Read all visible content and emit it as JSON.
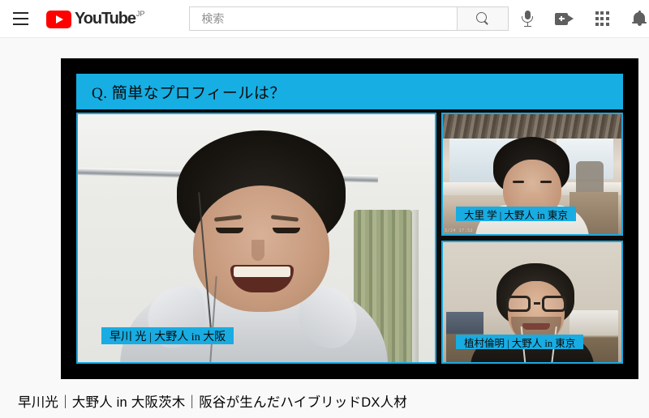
{
  "header": {
    "menu_icon": "hamburger-icon",
    "logo": {
      "wordmark": "YouTube",
      "country_code": "JP",
      "play_icon": "play-triangle-icon",
      "brand_color": "#ff0000"
    },
    "search": {
      "value": "",
      "placeholder": "検索",
      "button_icon": "search-icon"
    },
    "icons": [
      {
        "name": "microphone-icon",
        "label": "音声で検索"
      },
      {
        "name": "video-camera-plus-icon",
        "label": "作成"
      },
      {
        "name": "apps-grid-icon",
        "label": "YouTube アプリ"
      },
      {
        "name": "notification-bell-icon",
        "label": "通知"
      }
    ]
  },
  "player": {
    "question_banner": {
      "text": "Q. 簡単なプロフィールは？",
      "background": "#16aee3",
      "text_color": "#0b0b0b"
    },
    "accent_color": "#1aa9e0",
    "frame_color": "#000000",
    "tiles": [
      {
        "id": "main-speaker",
        "position": "left-large",
        "nameplate": "早川 光 | 大野人 in 大阪",
        "nameplate_background": "#18ace2"
      },
      {
        "id": "participant-top-right",
        "position": "top-right",
        "nameplate": "大里 学 | 大野人 in 東京",
        "nameplate_background": "#18ace2",
        "overlay_timestamp": "3/24 17:52"
      },
      {
        "id": "participant-bottom-right",
        "position": "bottom-right",
        "nameplate": "植村倫明 | 大野人 in 東京",
        "nameplate_background": "#18ace2"
      }
    ]
  },
  "video": {
    "title": "早川光｜大野人 in 大阪茨木｜阪谷が生んだハイブリッドDX人材"
  }
}
